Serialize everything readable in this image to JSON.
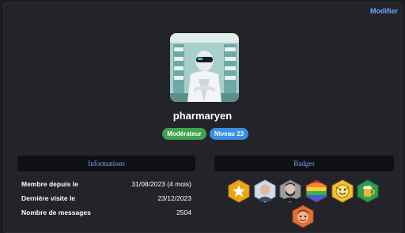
{
  "header": {
    "edit_label": "Modifier"
  },
  "profile": {
    "username": "pharmaryen",
    "tags": [
      {
        "label": "Modérateur",
        "color": "#3fa34d"
      },
      {
        "label": "Niveau 23",
        "color": "#3a8ee6"
      }
    ]
  },
  "informations": {
    "title": "Informations",
    "rows": [
      {
        "label": "Membre depuis le",
        "value": "31/08/2023 (4 mois)"
      },
      {
        "label": "Dernière visite le",
        "value": "23/12/2023"
      },
      {
        "label": "Nombre de messages",
        "value": "2504"
      }
    ]
  },
  "badges": {
    "title": "Badges",
    "items": [
      {
        "icon": "star-badge-icon",
        "color": "#e9a619"
      },
      {
        "icon": "man-portrait-badge-icon",
        "color": "#c9d8e6"
      },
      {
        "icon": "bearded-man-badge-icon",
        "color": "#b0b0b0"
      },
      {
        "icon": "rainbow-badge-icon",
        "color": "#e23b3b"
      },
      {
        "icon": "smiling-face-badge-icon",
        "color": "#f2c230"
      },
      {
        "icon": "beer-mug-badge-icon",
        "color": "#2e9f4b"
      },
      {
        "icon": "cartoon-face-badge-icon",
        "color": "#e26f3c"
      }
    ]
  }
}
